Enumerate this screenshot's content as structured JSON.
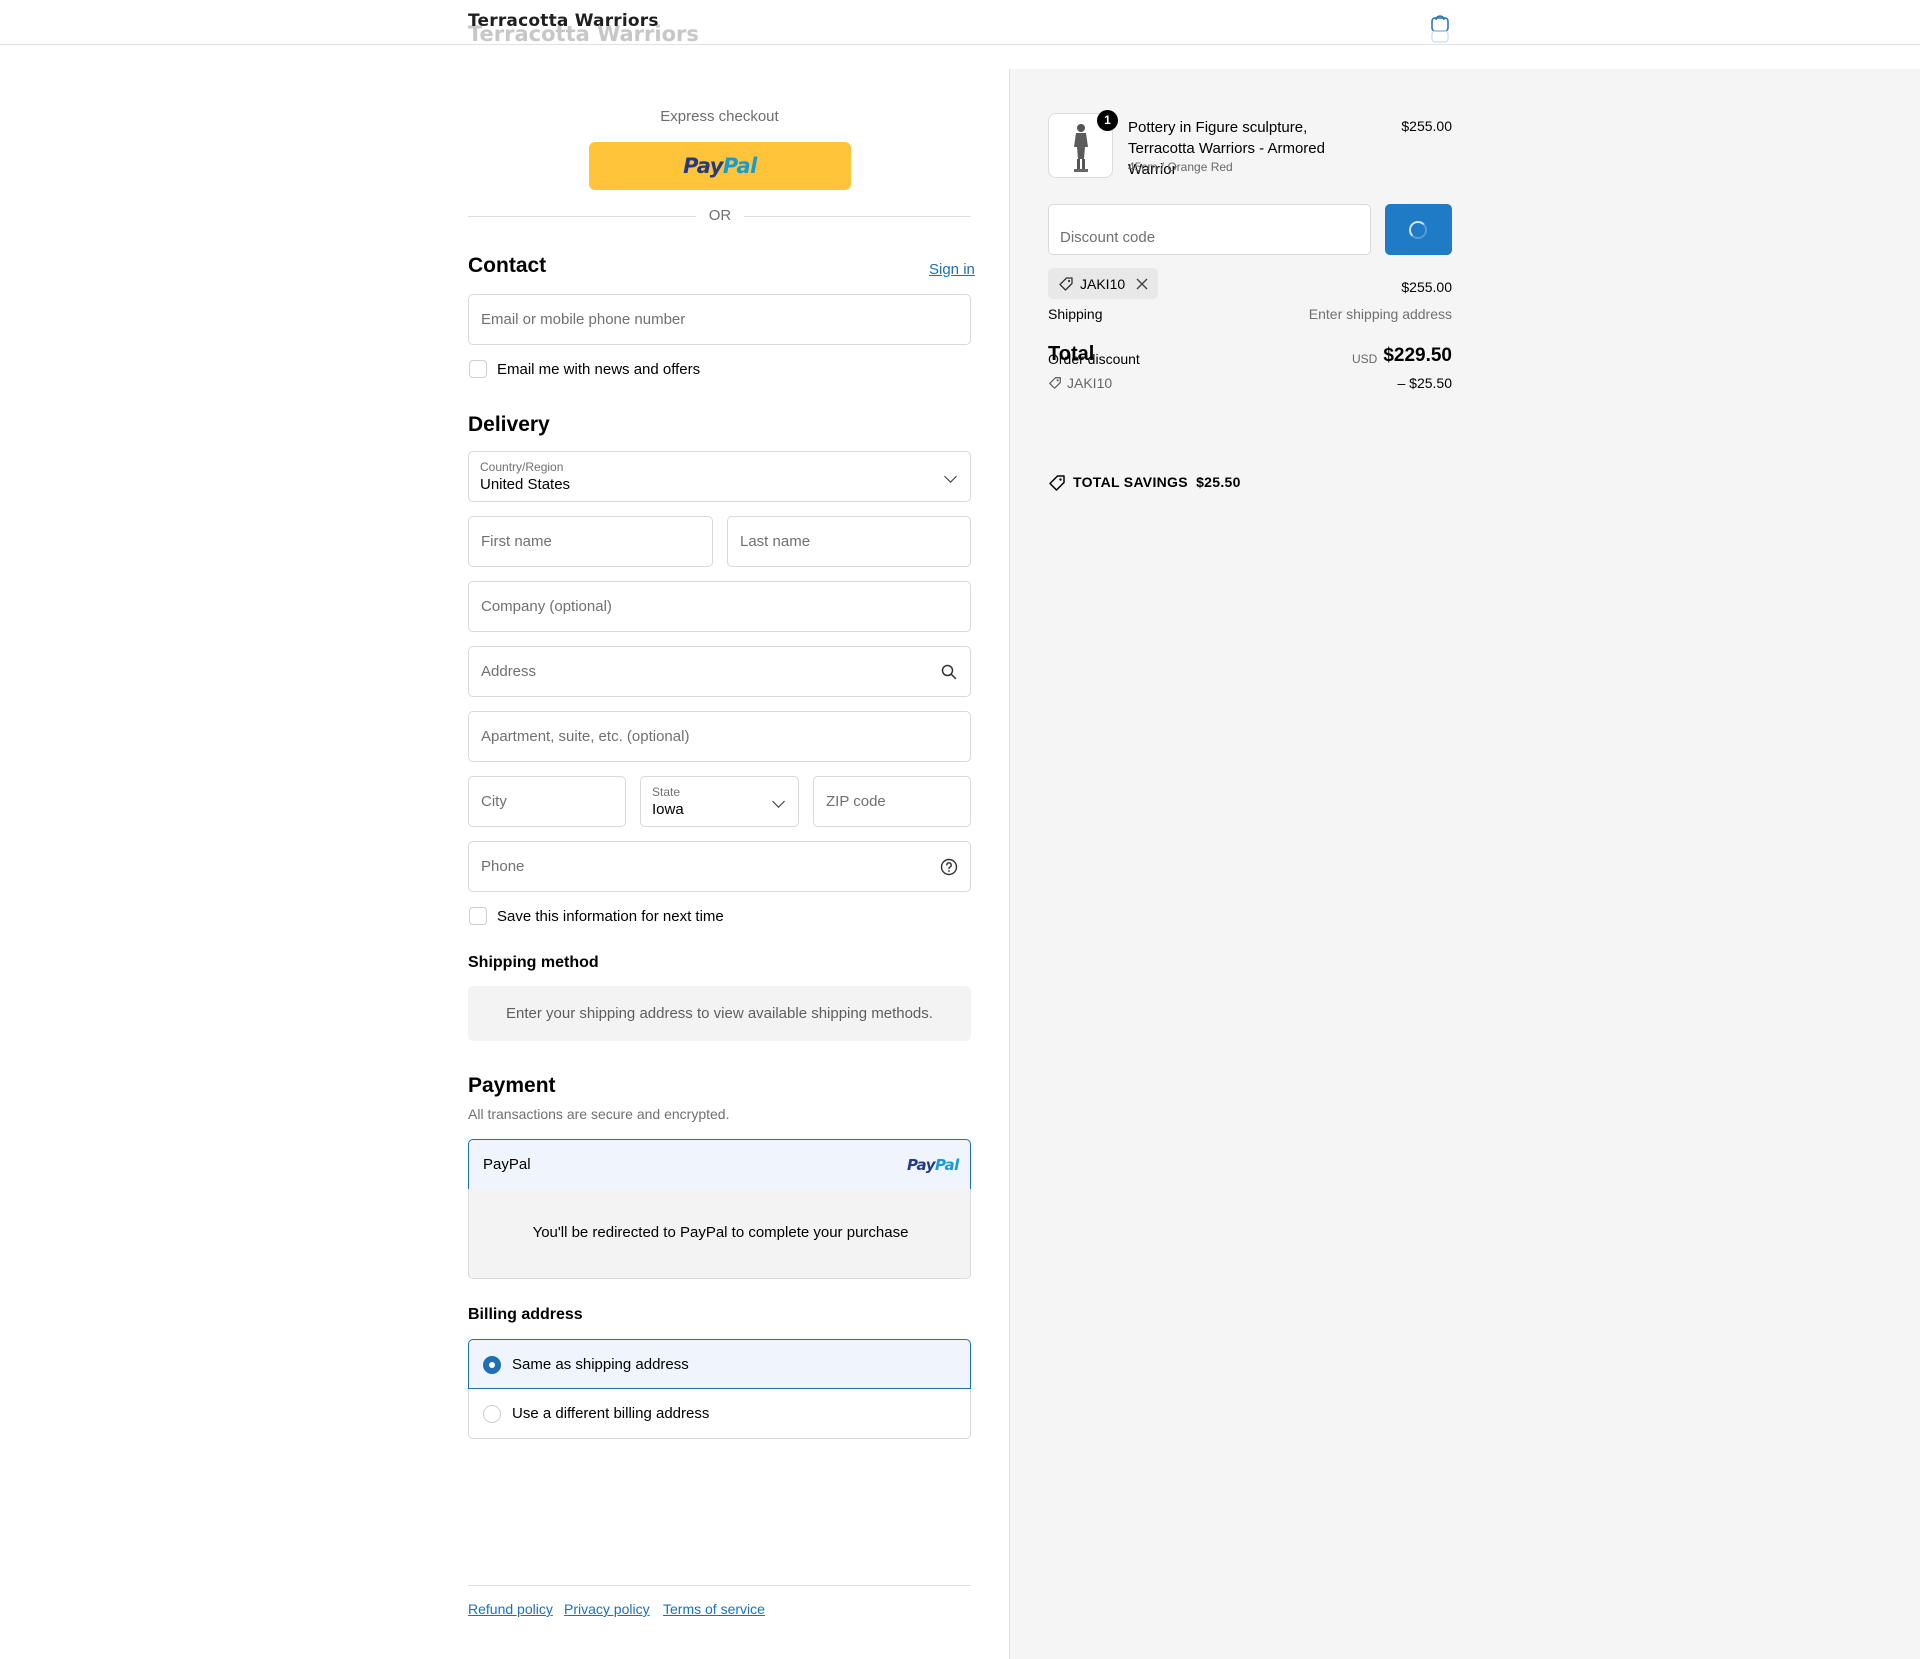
{
  "header": {
    "store_name": "Terracotta Warriors",
    "cart_icon": "shopping-bag-icon"
  },
  "express": {
    "title": "Express checkout",
    "paypal_logo": [
      "Pay",
      "Pal"
    ],
    "or": "OR"
  },
  "contact": {
    "title": "Contact",
    "sign_in": "Sign in",
    "email_placeholder": "Email or mobile phone number",
    "marketing_label": "Email me with news and offers"
  },
  "delivery": {
    "title": "Delivery",
    "country_label": "Country/Region",
    "country_value": "United States",
    "first_name": "First name",
    "last_name": "Last name",
    "company": "Company (optional)",
    "address": "Address",
    "apartment": "Apartment, suite, etc. (optional)",
    "city": "City",
    "state_label": "State",
    "state_value": "Iowa",
    "zip": "ZIP code",
    "phone": "Phone",
    "save_info_label": "Save this information for next time"
  },
  "shipping_method": {
    "title": "Shipping method",
    "message": "Enter your shipping address to view available shipping methods."
  },
  "payment": {
    "title": "Payment",
    "subtitle": "All transactions are secure and encrypted.",
    "method_label": "PayPal",
    "redirect_message": "You'll be redirected to PayPal to complete your purchase"
  },
  "billing": {
    "title": "Billing address",
    "option_same": "Same as shipping address",
    "option_different": "Use a different billing address",
    "selected": "same"
  },
  "footer": {
    "links": [
      "Refund policy",
      "Privacy policy",
      "Terms of service"
    ]
  },
  "summary": {
    "item": {
      "quantity": "1",
      "name": "Pottery in Figure sculpture, Terracotta Warriors - Armored Warrior",
      "variant": "45cm / Orange Red",
      "price": "$255.00"
    },
    "discount_placeholder": "Discount code",
    "applied_code": "JAKI10",
    "subtotal_value": "$255.00",
    "shipping_label": "Shipping",
    "shipping_value": "Enter shipping address",
    "order_discount_label": "Order discount",
    "discount_code": "JAKI10",
    "discount_value": "– $25.50",
    "total_label": "Total",
    "currency": "USD",
    "total_value": "$229.50",
    "savings_label": "TOTAL SAVINGS",
    "savings_value": "$25.50"
  },
  "colors": {
    "accent": "#1f6fb2",
    "paypal_yellow": "#ffc439",
    "summary_bg": "#f5f5f5"
  }
}
